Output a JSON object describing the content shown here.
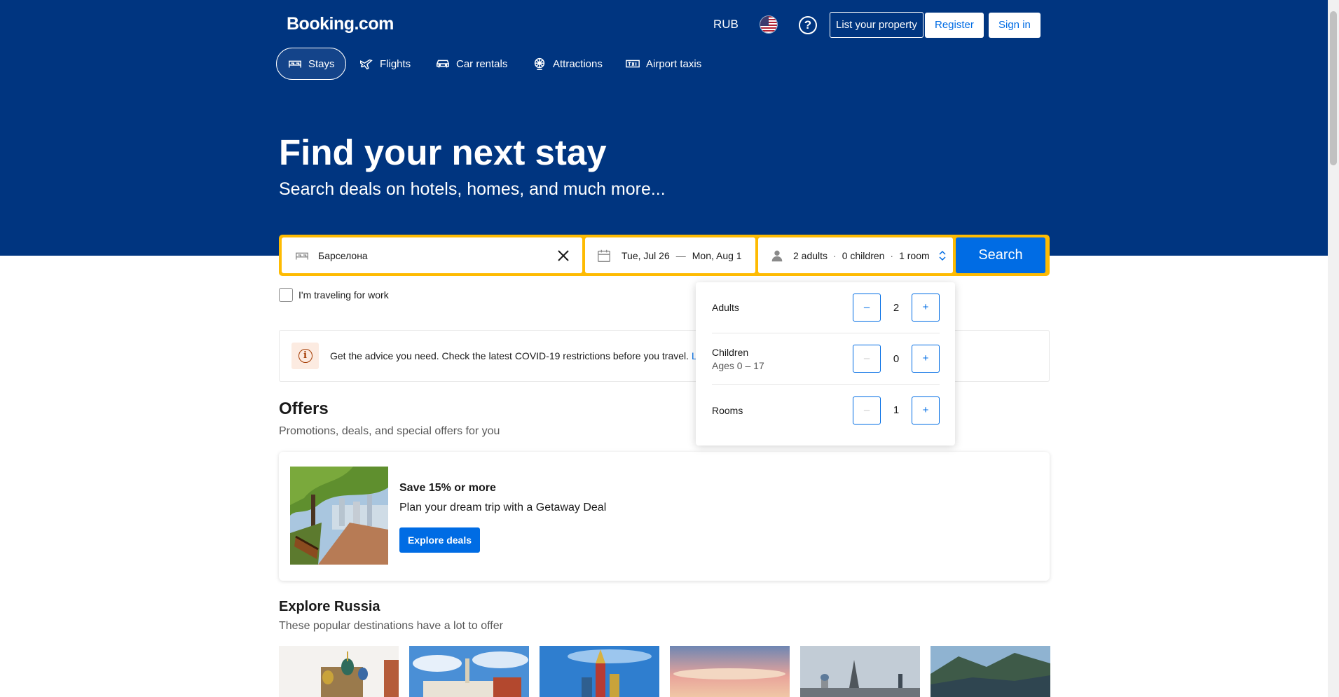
{
  "header": {
    "logo": "Booking.com",
    "currency": "RUB",
    "list_property": "List your property",
    "register": "Register",
    "sign_in": "Sign in"
  },
  "nav": {
    "items": [
      {
        "label": "Stays",
        "icon": "bed-icon",
        "active": true
      },
      {
        "label": "Flights",
        "icon": "plane-icon",
        "active": false
      },
      {
        "label": "Car rentals",
        "icon": "car-icon",
        "active": false
      },
      {
        "label": "Attractions",
        "icon": "attractions-icon",
        "active": false
      },
      {
        "label": "Airport taxis",
        "icon": "taxi-icon",
        "active": false
      }
    ]
  },
  "hero": {
    "title": "Find your next stay",
    "subtitle": "Search deals on hotels, homes, and much more..."
  },
  "search": {
    "destination_value": "Барселона",
    "checkin": "Tue, Jul 26",
    "date_separator": "—",
    "checkout": "Mon, Aug 1",
    "adults_summary": "2 adults",
    "children_summary": "0 children",
    "rooms_summary": "1 room",
    "guest_separator": "·",
    "button": "Search",
    "work_travel_label": "I'm traveling for work"
  },
  "notice": {
    "text": "Get the advice you need. Check the latest COVID-19 restrictions before you travel.",
    "link": "L"
  },
  "guests_dropdown": {
    "rows": [
      {
        "label": "Adults",
        "sub": "",
        "value": "2",
        "minus_enabled": true
      },
      {
        "label": "Children",
        "sub": "Ages 0 – 17",
        "value": "0",
        "minus_enabled": false
      },
      {
        "label": "Rooms",
        "sub": "",
        "value": "1",
        "minus_enabled": false
      }
    ],
    "minus": "–",
    "plus": "+"
  },
  "offers": {
    "title": "Offers",
    "subtitle": "Promotions, deals, and special offers for you",
    "card": {
      "title": "Save 15% or more",
      "description": "Plan your dream trip with a Getaway Deal",
      "button": "Explore deals"
    }
  },
  "explore": {
    "title": "Explore Russia",
    "subtitle": "These popular destinations have a lot to offer"
  },
  "colors": {
    "brand_blue": "#003580",
    "action_blue": "#006ce4",
    "search_yellow": "#febb02"
  }
}
